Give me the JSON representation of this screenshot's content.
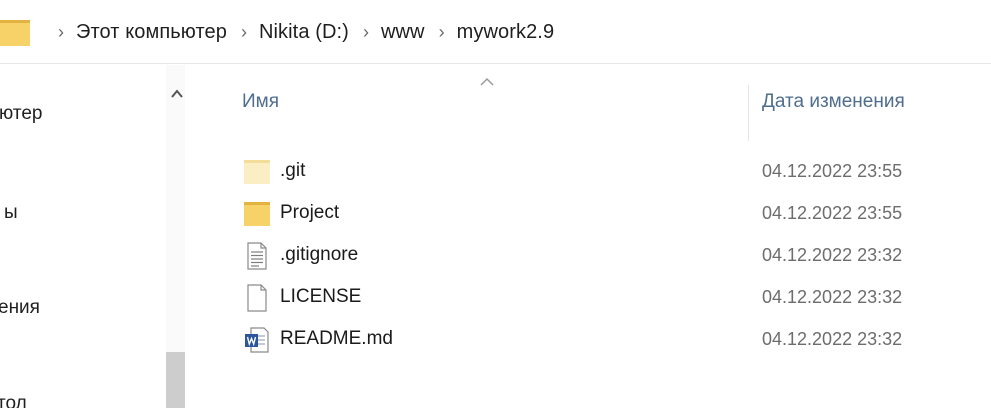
{
  "address_bar": {
    "separator": "›",
    "crumbs": [
      "Этот компьютер",
      "Nikita (D:)",
      "www",
      "mywork2.9"
    ]
  },
  "nav_pane": {
    "items": [
      "ютер",
      "ы",
      "ения",
      "тол"
    ]
  },
  "file_list": {
    "columns": {
      "name": "Имя",
      "date_modified": "Дата изменения"
    },
    "rows": [
      {
        "name": ".git",
        "date": "04.12.2022 23:55",
        "icon": "folder-hidden-icon"
      },
      {
        "name": "Project",
        "date": "04.12.2022 23:55",
        "icon": "folder-icon"
      },
      {
        "name": ".gitignore",
        "date": "04.12.2022 23:32",
        "icon": "text-file-icon"
      },
      {
        "name": "LICENSE",
        "date": "04.12.2022 23:32",
        "icon": "blank-file-icon"
      },
      {
        "name": "README.md",
        "date": "04.12.2022 23:32",
        "icon": "word-document-icon"
      }
    ]
  },
  "colors": {
    "folder": "#f6d268",
    "folder_dark": "#e3b341",
    "folder_hidden": "#fbeec4",
    "header_text": "#4f6d8f",
    "date_text": "#6d6d6d",
    "word_blue": "#2b579a"
  }
}
